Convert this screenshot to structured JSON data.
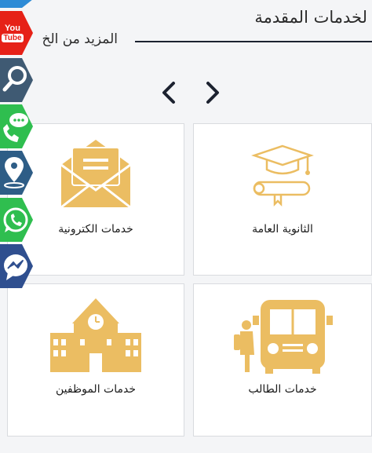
{
  "header": {
    "title": "لخدمات المقدمة",
    "more_link": "المزيد من الخ"
  },
  "colors": {
    "icon": "#ebbd62",
    "youtube": "#e62117",
    "search": "#3f5a73",
    "chat": "#2fbe4f",
    "location": "#2e5d86",
    "whatsapp": "#2fbe4f",
    "messenger": "#2f4f8f",
    "text": "#1a1a1a"
  },
  "cards": [
    {
      "label": "خدمات الكترونية",
      "icon": "envelope-icon"
    },
    {
      "label": "الثانوية العامة",
      "icon": "graduation-icon"
    },
    {
      "label": "خدمات الموظفين",
      "icon": "school-icon"
    },
    {
      "label": "خدمات الطالب",
      "icon": "bus-icon"
    }
  ],
  "social": {
    "youtube": {
      "line1": "You",
      "line2": "Tube"
    }
  }
}
